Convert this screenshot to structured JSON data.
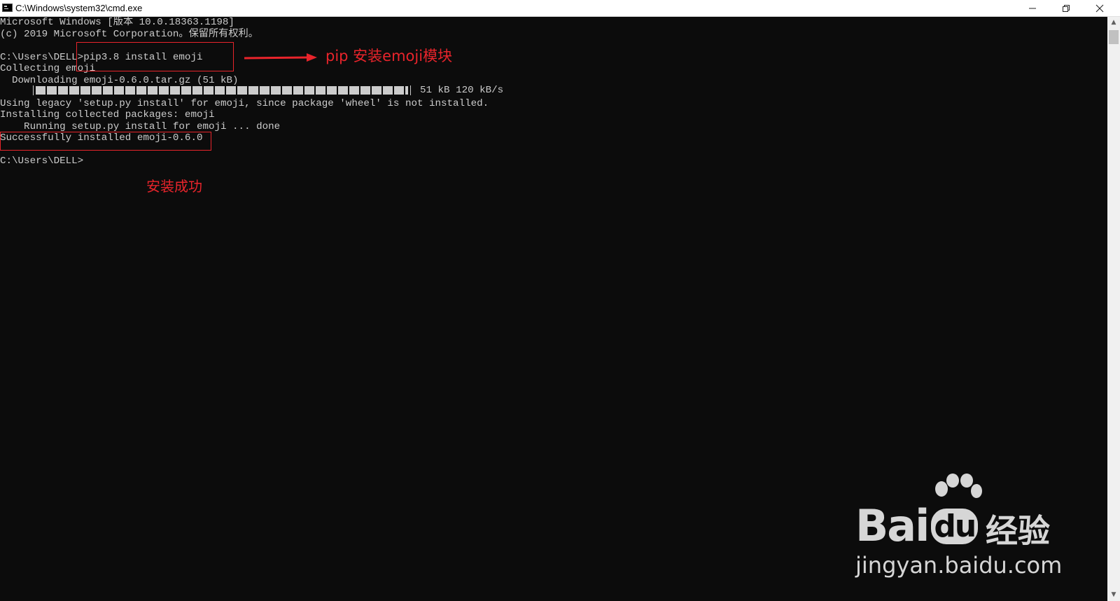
{
  "window": {
    "title": "C:\\Windows\\system32\\cmd.exe",
    "icon": "console-app-icon",
    "controls": [
      "minimize-icon",
      "restore-icon",
      "close-icon"
    ]
  },
  "console": {
    "lines": [
      "Microsoft Windows [版本 10.0.18363.1198]",
      "(c) 2019 Microsoft Corporation。保留所有权利。",
      "",
      "C:\\Users\\DELL>pip3.8 install emoji",
      "Collecting emoji",
      "  Downloading emoji-0.6.0.tar.gz (51 kB)",
      "",
      "Using legacy 'setup.py install' for emoji, since package 'wheel' is not installed.",
      "Installing collected packages: emoji",
      "    Running setup.py install for emoji ... done",
      "Successfully installed emoji-0.6.0",
      "",
      "C:\\Users\\DELL>"
    ],
    "progress": {
      "fraction": 1.0,
      "text": "51 kB 120 kB/s"
    }
  },
  "annotations": {
    "pip_label": "pip 安装emoji模块",
    "success_label": "安装成功",
    "color": "#e8242b"
  },
  "watermark": {
    "brand": "Bai",
    "brand_du": "du",
    "cn": "经验",
    "url": "jingyan.baidu.com"
  },
  "colors": {
    "console_bg": "#0c0c0c",
    "console_text": "#cccccc"
  }
}
